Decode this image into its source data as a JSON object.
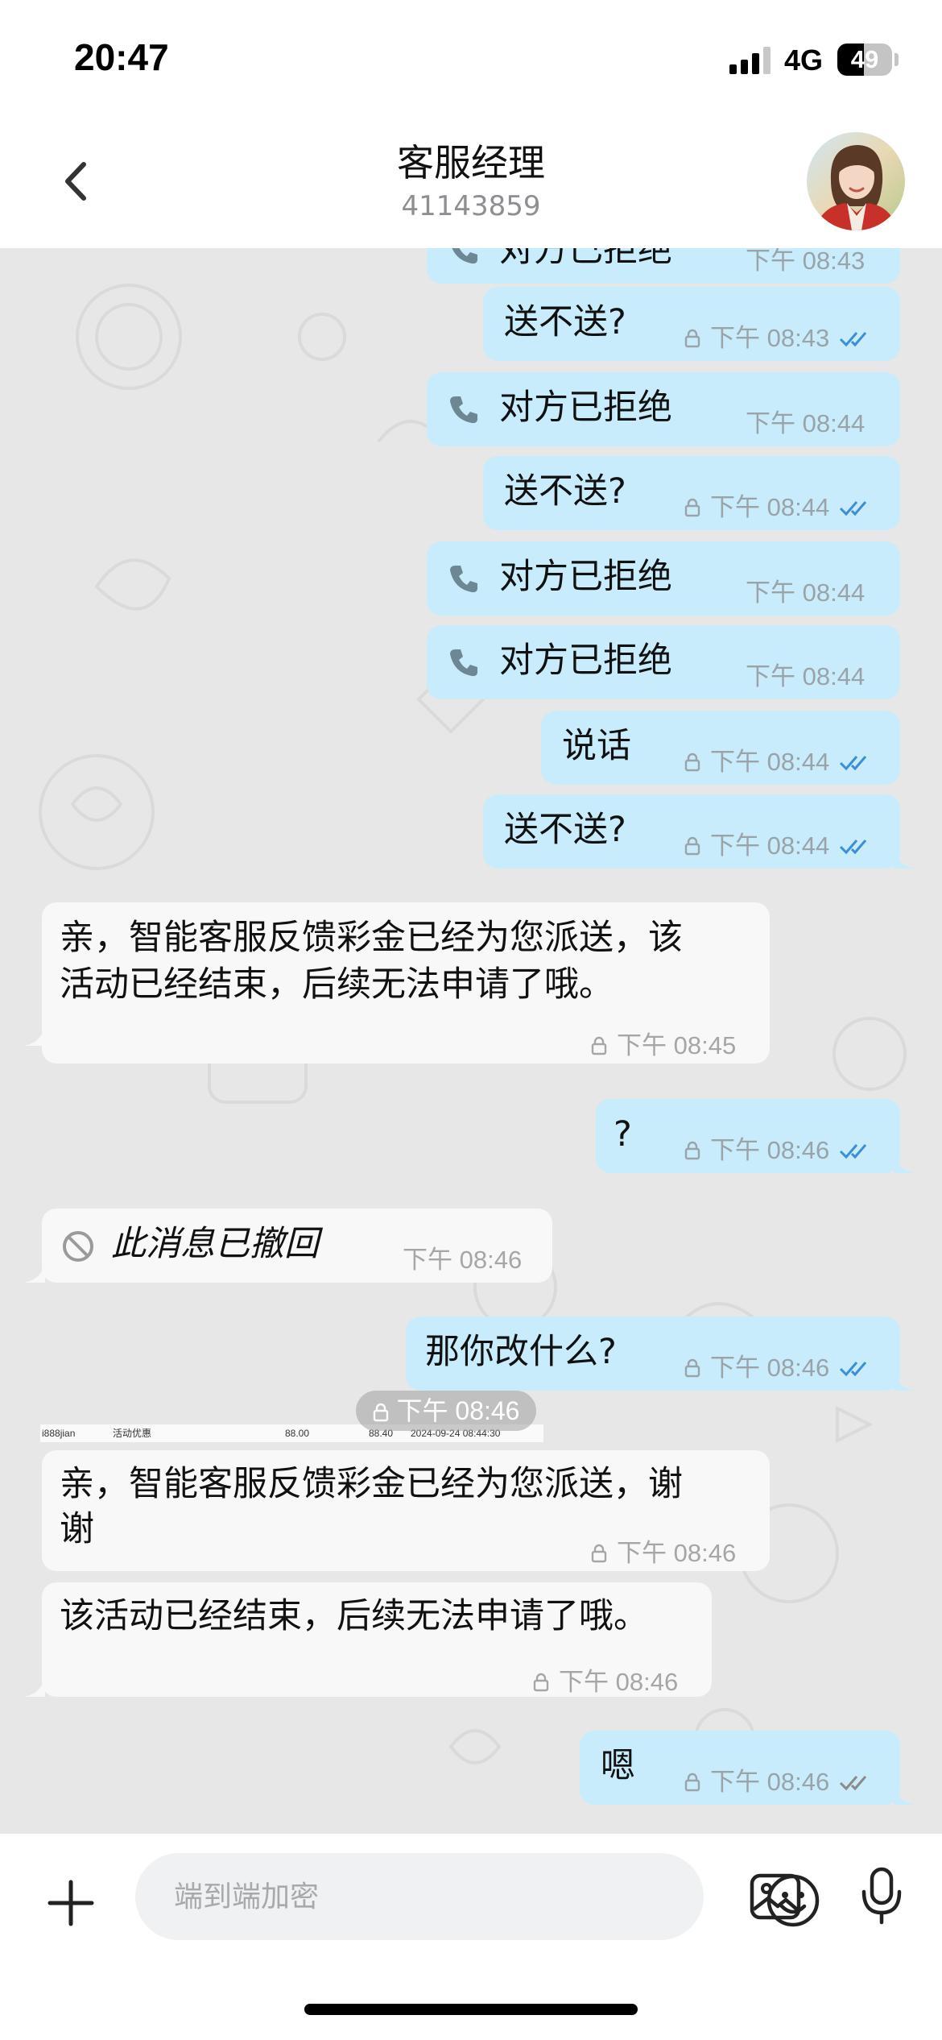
{
  "status_bar": {
    "time": "20:47",
    "network": "4G",
    "battery": "49",
    "battery_level": 0.49
  },
  "header": {
    "title": "客服经理",
    "subtitle": "41143859"
  },
  "messages": [
    {
      "dir": "out",
      "kind": "call",
      "text": "对方已拒绝",
      "time": "下午 08:43"
    },
    {
      "dir": "out",
      "kind": "text",
      "text": "送不送?",
      "time": "下午 08:43",
      "status": "read"
    },
    {
      "dir": "out",
      "kind": "call",
      "text": "对方已拒绝",
      "time": "下午 08:44"
    },
    {
      "dir": "out",
      "kind": "text",
      "text": "送不送?",
      "time": "下午 08:44",
      "status": "read"
    },
    {
      "dir": "out",
      "kind": "call",
      "text": "对方已拒绝",
      "time": "下午 08:44"
    },
    {
      "dir": "out",
      "kind": "call",
      "text": "对方已拒绝",
      "time": "下午 08:44"
    },
    {
      "dir": "out",
      "kind": "text",
      "text": "说话",
      "time": "下午 08:44",
      "status": "read"
    },
    {
      "dir": "out",
      "kind": "text",
      "text": "送不送?",
      "time": "下午 08:44",
      "status": "read"
    },
    {
      "dir": "in",
      "kind": "text",
      "line1": "亲，智能客服反馈彩金已经为您派送，该",
      "line2": "活动已经结束，后续无法申请了哦。",
      "time": "下午 08:45"
    },
    {
      "dir": "out",
      "kind": "text",
      "text": "?",
      "time": "下午 08:46",
      "status": "read"
    },
    {
      "dir": "in",
      "kind": "revoked",
      "text": "此消息已撤回",
      "time": "下午 08:46"
    },
    {
      "dir": "out",
      "kind": "text",
      "text": "那你改什么?",
      "time": "下午 08:46",
      "status": "read"
    },
    {
      "dir": "in",
      "kind": "image",
      "time": "下午 08:46",
      "strip": [
        "i888jian",
        "活动优惠",
        "88.00",
        "88.40",
        "2024-09-24 08:44:30"
      ]
    },
    {
      "dir": "in",
      "kind": "text",
      "line1": "亲，智能客服反馈彩金已经为您派送，谢",
      "line2": "谢",
      "time": "下午 08:46"
    },
    {
      "dir": "in",
      "kind": "text",
      "text": "该活动已经结束，后续无法申请了哦。",
      "time": "下午 08:46"
    },
    {
      "dir": "out",
      "kind": "text",
      "text": "嗯",
      "time": "下午 08:46",
      "status": "delivered"
    }
  ],
  "composer": {
    "placeholder": "端到端加密"
  },
  "colors": {
    "outgoing_bubble": "#c8ecfc",
    "incoming_bubble": "#f8f8f8",
    "chat_background": "#e7e7e7",
    "read_ticks": "#3b8fd6",
    "delivered_ticks": "#8a8a8a"
  },
  "icons": {
    "back": "chevron-left-icon",
    "call": "phone-icon",
    "lock": "lock-icon",
    "read": "double-check-icon",
    "revoked": "prohibited-icon",
    "plus": "plus-icon",
    "emoji": "smiley-icon",
    "image": "image-icon",
    "mic": "microphone-icon"
  }
}
